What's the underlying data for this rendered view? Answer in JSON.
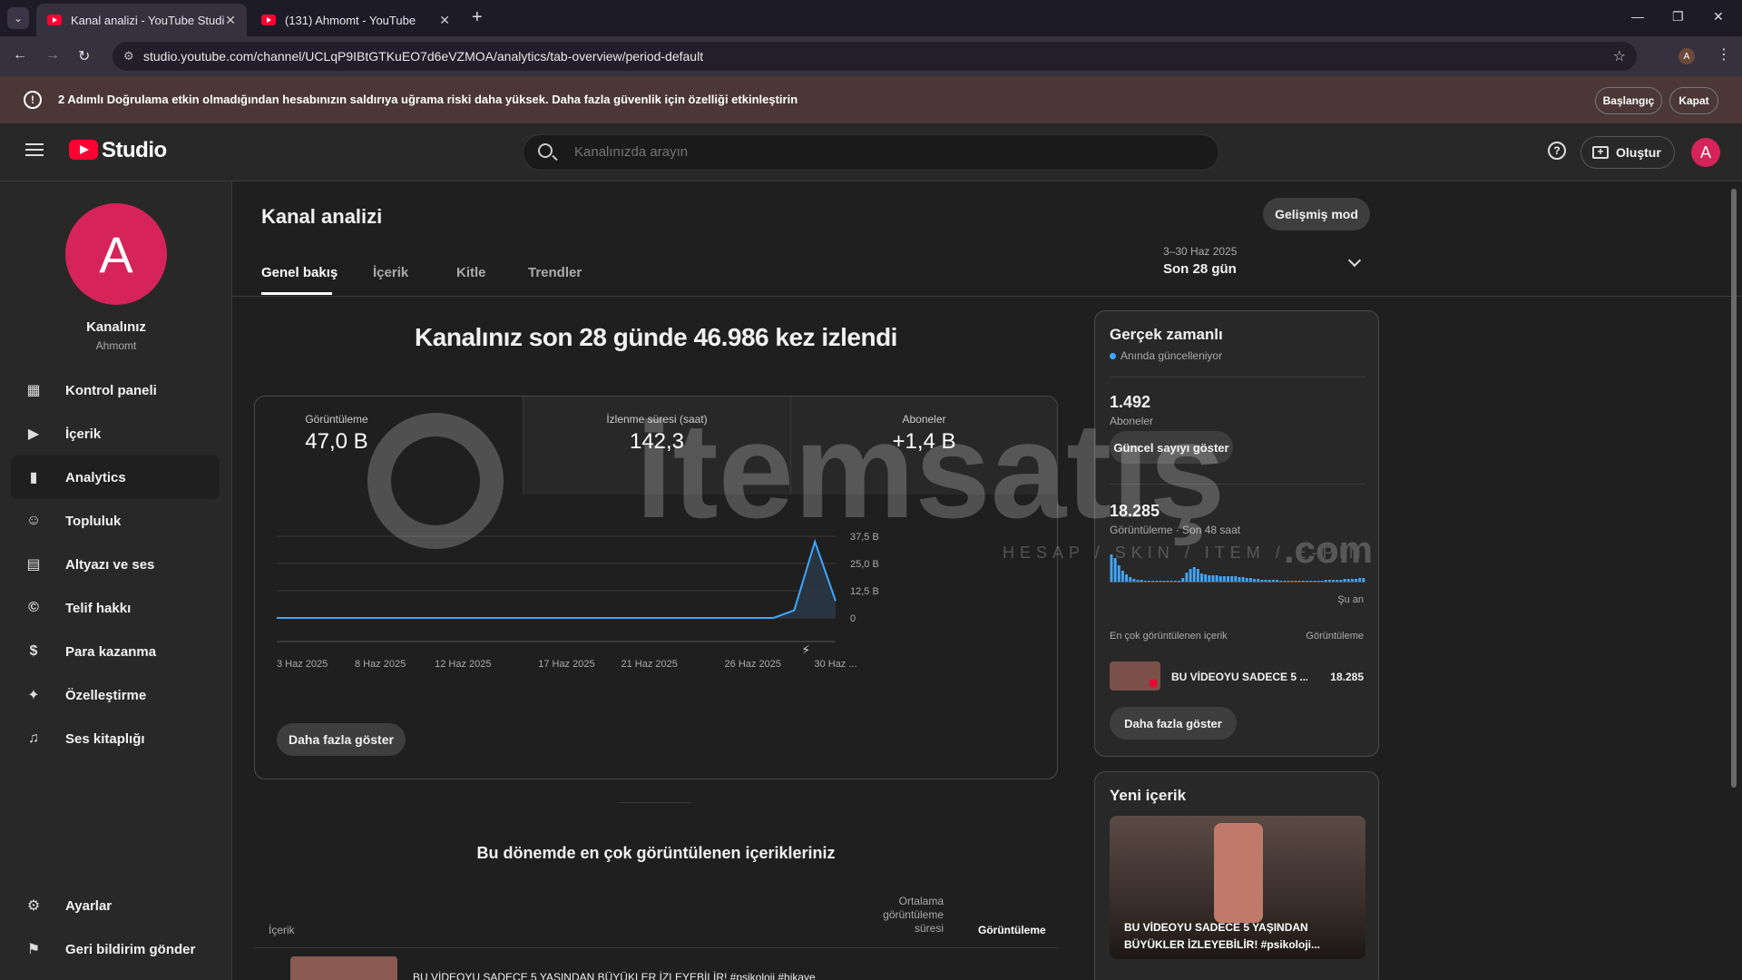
{
  "browser": {
    "tabs": [
      {
        "label": "Kanal analizi - YouTube Studio",
        "active": true
      },
      {
        "label": "(131) Ahmomt - YouTube",
        "active": false
      }
    ],
    "url": "studio.youtube.com/channel/UCLqP9IBtGTKuEO7d6eVZMOA/analytics/tab-overview/period-default",
    "profile_initial": "A"
  },
  "warning": {
    "text": "2 Adımlı Doğrulama etkin olmadığından hesabınızın saldırıya uğrama riski daha yüksek. Daha fazla güvenlik için özelliği etkinleştirin",
    "start_label": "Başlangıç",
    "close_label": "Kapat"
  },
  "header": {
    "logo_text": "Studio",
    "search_placeholder": "Kanalınızda arayın",
    "create_label": "Oluştur",
    "avatar_initial": "A"
  },
  "sidebar": {
    "avatar_initial": "A",
    "channel_name": "Kanalınız",
    "channel_handle": "Ahmomt",
    "items": [
      {
        "label": "Kontrol paneli",
        "icon": "dashboard-icon"
      },
      {
        "label": "İçerik",
        "icon": "content-icon"
      },
      {
        "label": "Analytics",
        "icon": "analytics-icon",
        "active": true
      },
      {
        "label": "Topluluk",
        "icon": "community-icon"
      },
      {
        "label": "Altyazı ve ses",
        "icon": "subtitles-icon"
      },
      {
        "label": "Telif hakkı",
        "icon": "copyright-icon"
      },
      {
        "label": "Para kazanma",
        "icon": "dollar-icon"
      },
      {
        "label": "Özelleştirme",
        "icon": "magic-wand-icon"
      },
      {
        "label": "Ses kitaplığı",
        "icon": "audio-library-icon"
      }
    ],
    "bottom": [
      {
        "label": "Ayarlar",
        "icon": "gear-icon"
      },
      {
        "label": "Geri bildirim gönder",
        "icon": "feedback-icon"
      }
    ]
  },
  "main": {
    "title": "Kanal analizi",
    "advanced_label": "Gelişmiş mod",
    "tabs": [
      "Genel bakış",
      "İçerik",
      "Kitle",
      "Trendler"
    ],
    "date_range_sub": "3–30 Haz 2025",
    "date_range_main": "Son 28 gün",
    "headline": "Kanalınız son 28 günde 46.986 kez izlendi",
    "kpis": [
      {
        "label": "Görüntüleme",
        "value": "47,0 B"
      },
      {
        "label": "İzlenme süresi (saat)",
        "value": "142,3"
      },
      {
        "label": "Aboneler",
        "value": "+1,4 B"
      }
    ],
    "more_label": "Daha fazla göster",
    "top_content_title": "Bu dönemde en çok görüntülenen içerikleriniz",
    "table_headers": {
      "content": "İçerik",
      "avg_duration": "Ortalama görüntüleme süresi",
      "views": "Görüntüleme"
    },
    "table_rows": [
      {
        "title": "BU VİDEOYU SADECE 5 YAŞINDAN BÜYÜKLER İZLEYEBİLİR! #psikoloji #hikaye"
      }
    ]
  },
  "chart_data": {
    "type": "line",
    "title": "",
    "xlabel": "",
    "ylabel": "",
    "x_tick_labels": [
      "3 Haz 2025",
      "8 Haz 2025",
      "12 Haz 2025",
      "17 Haz 2025",
      "21 Haz 2025",
      "26 Haz 2025",
      "30 Haz ..."
    ],
    "y_tick_labels": [
      "0",
      "12,5 B",
      "25,0 B",
      "37,5 B"
    ],
    "ylim": [
      0,
      37500
    ],
    "series": [
      {
        "x": [
          "3 Haz",
          "4 Haz",
          "5 Haz",
          "6 Haz",
          "7 Haz",
          "8 Haz",
          "9 Haz",
          "10 Haz",
          "11 Haz",
          "12 Haz",
          "13 Haz",
          "14 Haz",
          "15 Haz",
          "16 Haz",
          "17 Haz",
          "18 Haz",
          "19 Haz",
          "20 Haz",
          "21 Haz",
          "22 Haz",
          "23 Haz",
          "24 Haz",
          "25 Haz",
          "26 Haz",
          "27 Haz",
          "28 Haz",
          "29 Haz",
          "30 Haz"
        ],
        "values": [
          0,
          0,
          0,
          0,
          0,
          0,
          0,
          0,
          0,
          0,
          0,
          0,
          0,
          0,
          0,
          0,
          0,
          0,
          0,
          0,
          0,
          0,
          0,
          0,
          0,
          3500,
          35000,
          7800
        ]
      }
    ],
    "grid": true,
    "colors": {
      "line": "#3ea6ff",
      "fill": "#2b3a48"
    }
  },
  "realtime": {
    "title": "Gerçek zamanlı",
    "live_text": "Anında güncelleniyor",
    "subs_value": "1.492",
    "subs_label": "Aboneler",
    "show_count_label": "Güncel sayıyı göster",
    "views_value": "18.285",
    "views_label": "Görüntüleme · Son 48 saat",
    "now_label": "Şu an",
    "list_header_left": "En çok görüntülenen içerik",
    "list_header_right": "Görüntüleme",
    "top_video_title": "BU VİDEOYU SADECE 5 ...",
    "top_video_views": "18.285",
    "more_label": "Daha fazla göster"
  },
  "new_content": {
    "title": "Yeni içerik",
    "video_title": "BU VİDEOYU SADECE 5 YAŞINDAN BÜYÜKLER İZLEYEBİLİR! #psikoloji..."
  },
  "watermark": {
    "text": "itemsatış",
    "sub": "HESAP / SKIN / ITEM / E-PIN",
    "suffix": ".com"
  }
}
